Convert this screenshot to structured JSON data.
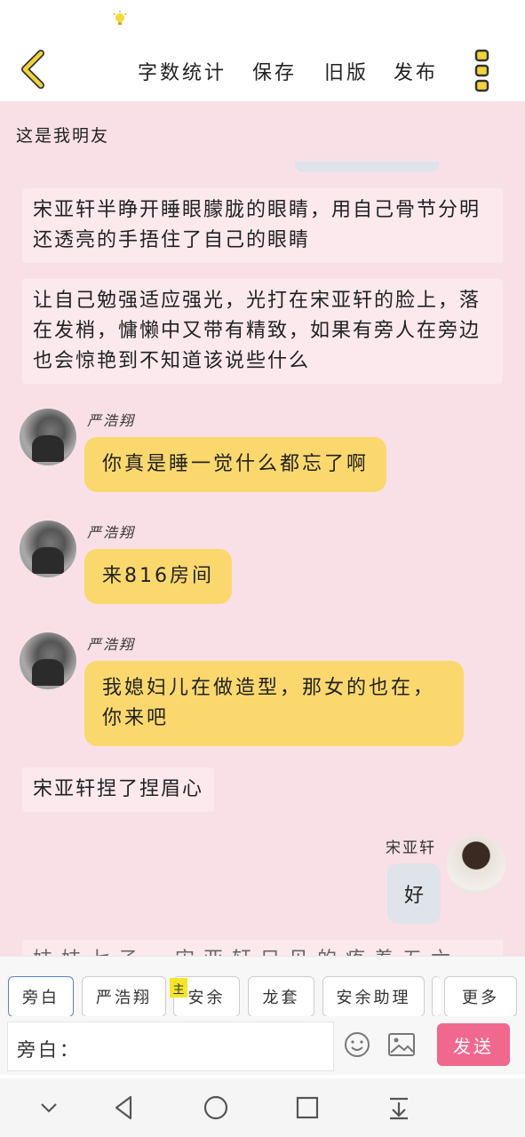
{
  "topnav": {
    "items": [
      "字数统计",
      "保存",
      "旧版",
      "发布"
    ]
  },
  "chat": {
    "section_title": "这是我明友",
    "messages": [
      "宋亚轩半睁开睡眼朦胧的眼睛，用自己骨节分明还透亮的手捂住了自己的眼睛",
      "让自己勉强适应强光，光打在宋亚轩的脸上，落在发梢，慵懒中又带有精致，如果有旁人在旁边也会惊艳到不知道该说些什么",
      "你真是睡一觉什么都忘了啊",
      "来816房间",
      "我媳妇儿在做造型，那女的也在，你来吧",
      "宋亚轩捏了捏眉心",
      "好"
    ],
    "speaker_yan": "严浩翔",
    "speaker_song": "宋亚轩",
    "cut_line": "妹妹七子、宋亚轩只见的疼着五六、四维考点"
  },
  "roles": {
    "items": [
      "旁白",
      "严浩翔",
      "安余",
      "龙套",
      "安余助理"
    ],
    "more": "更多",
    "main_badge": "主"
  },
  "input": {
    "prefix": "旁白：",
    "send": "发送"
  },
  "colors": {
    "chat_bg": "#f9e0e7",
    "bubble_yellow": "#fbd86e",
    "send_pink": "#f0688e",
    "back_arrow": "#f2d43a"
  }
}
